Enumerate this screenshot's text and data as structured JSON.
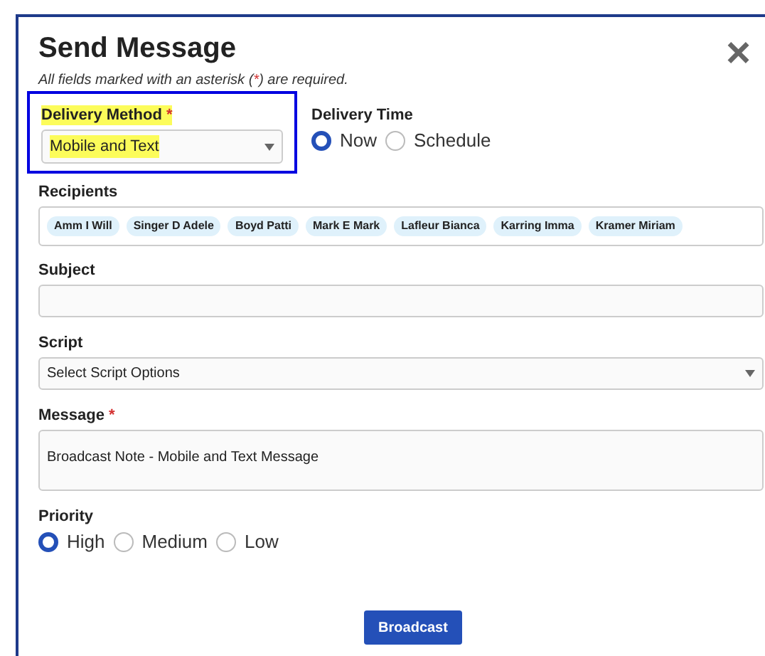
{
  "dialog": {
    "title": "Send Message",
    "close_label": "×",
    "required_note": {
      "before": "All fields marked with an asterisk (",
      "mark": "*",
      "after": ") are required."
    }
  },
  "delivery_method": {
    "label": "Delivery Method",
    "required_mark": "*",
    "value": "Mobile and Text",
    "highlighted": true
  },
  "delivery_time": {
    "label": "Delivery Time",
    "options": [
      {
        "label": "Now",
        "selected": true
      },
      {
        "label": "Schedule",
        "selected": false
      }
    ]
  },
  "recipients": {
    "label": "Recipients",
    "chips": [
      "Amm I Will",
      "Singer D Adele",
      "Boyd Patti",
      "Mark E Mark",
      "Lafleur Bianca",
      "Karring Imma",
      "Kramer Miriam"
    ]
  },
  "subject": {
    "label": "Subject"
  },
  "script": {
    "label": "Script",
    "value": "Select Script Options"
  },
  "message": {
    "label": "Message",
    "required_mark": "*",
    "value": "Broadcast Note - Mobile and Text Message"
  },
  "priority": {
    "label": "Priority",
    "options": [
      {
        "label": "High",
        "selected": true
      },
      {
        "label": "Medium",
        "selected": false
      },
      {
        "label": "Low",
        "selected": false
      }
    ]
  },
  "buttons": [
    "Broadcast"
  ]
}
